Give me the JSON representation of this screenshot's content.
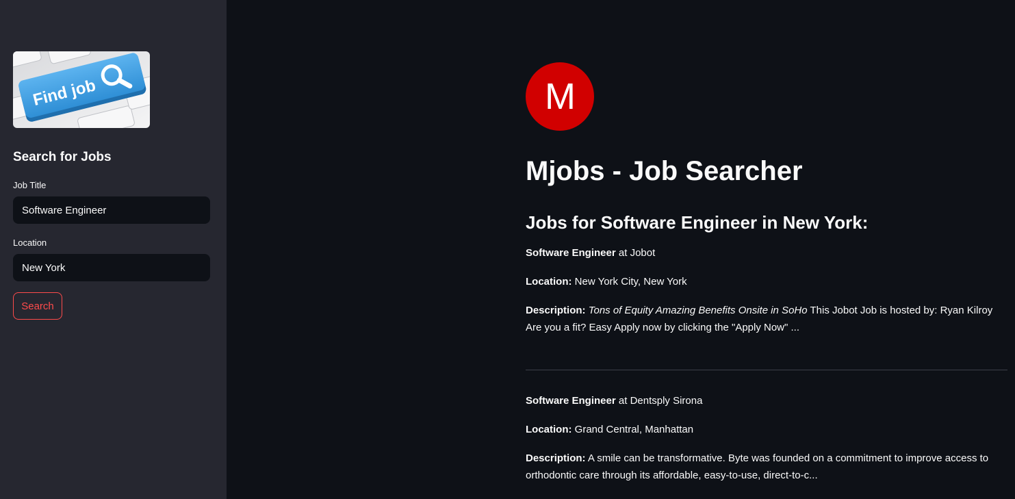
{
  "sidebar": {
    "banner": {
      "text": "Find job",
      "icon": "magnifier-icon"
    },
    "heading": "Search for Jobs",
    "job_title": {
      "label": "Job Title",
      "value": "Software Engineer"
    },
    "location": {
      "label": "Location",
      "value": "New York"
    },
    "search_button": "Search"
  },
  "main": {
    "logo_letter": "M",
    "title": "Mjobs - Job Searcher",
    "results_heading": "Jobs for Software Engineer in New York:",
    "jobs": [
      {
        "title": "Software Engineer",
        "at": "at",
        "company": "Jobot",
        "location_label": "Location:",
        "location": "New York City, New York",
        "description_label": "Description:",
        "description_italic": "Tons of Equity Amazing Benefits Onsite in SoHo",
        "description": "This Jobot Job is hosted by: Ryan Kilroy Are you a fit? Easy Apply now by clicking the \"Apply Now\" ..."
      },
      {
        "title": "Software Engineer",
        "at": "at",
        "company": "Dentsply Sirona",
        "location_label": "Location:",
        "location": "Grand Central, Manhattan",
        "description_label": "Description:",
        "description_italic": "",
        "description": "A smile can be transformative. Byte was founded on a commitment to improve access to orthodontic care through its affordable, easy-to-use, direct-to-c..."
      }
    ]
  },
  "colors": {
    "sidebar_bg": "#262730",
    "main_bg": "#0e1117",
    "accent": "#ff4b4b",
    "logo_red": "#d10000",
    "banner_key_blue": "#3a9ae0"
  }
}
